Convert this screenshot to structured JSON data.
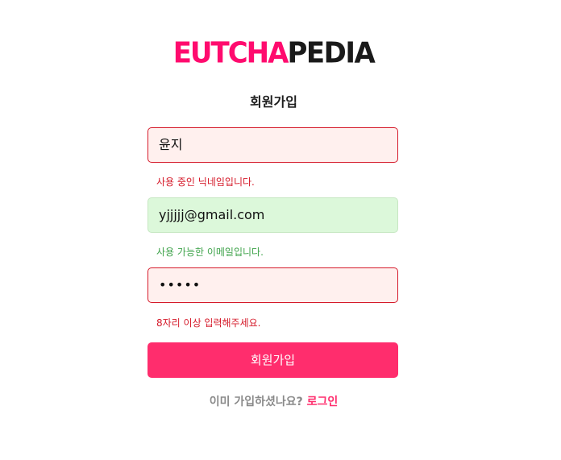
{
  "logo": {
    "part1": "EUTCHA",
    "part2": "PEDIA",
    "color_primary": "#ff0b6e",
    "color_secondary": "#1a1a1a"
  },
  "form": {
    "title": "회원가입",
    "nickname": {
      "value": "윤지",
      "message": "사용 중인 닉네임입니다.",
      "status": "error"
    },
    "email": {
      "value": "yjjjjj@gmail.com",
      "message": "사용 가능한 이메일입니다.",
      "status": "ok"
    },
    "password": {
      "value": "•••••",
      "message": "8자리 이상 입력해주세요.",
      "status": "error"
    },
    "submit_label": "회원가입"
  },
  "footer": {
    "question": "이미 가입하셨나요?",
    "login_label": "로그인"
  },
  "colors": {
    "accent": "#ff2d6d",
    "error": "#d51a2a",
    "success": "#3fa34b",
    "error_bg": "#fff0ee",
    "success_bg": "#dcf8da"
  }
}
